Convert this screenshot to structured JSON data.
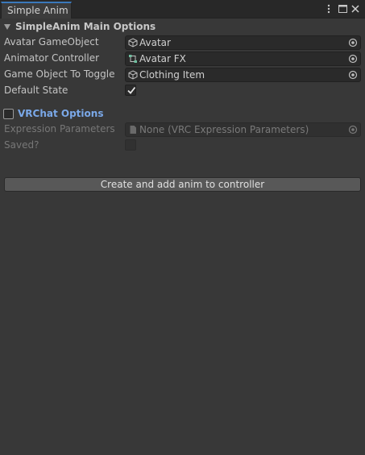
{
  "tab": {
    "title": "Simple Anim"
  },
  "window_controls": {
    "menu_icon": "kebab-menu-icon",
    "maximize_icon": "maximize-icon",
    "close_icon": "close-icon"
  },
  "main_section": {
    "title": "SimpleAnim Main Options",
    "expanded": true,
    "fields": [
      {
        "label": "Avatar GameObject",
        "value": "Avatar",
        "icon": "gameobject-icon"
      },
      {
        "label": "Animator Controller",
        "value": "Avatar FX",
        "icon": "animator-controller-icon"
      },
      {
        "label": "Game Object To Toggle",
        "value": "Clothing Item",
        "icon": "gameobject-icon"
      }
    ],
    "default_state": {
      "label": "Default State",
      "checked": true
    }
  },
  "vrchat_section": {
    "title": "VRChat Options",
    "enabled": false,
    "expression_parameters": {
      "label": "Expression Parameters",
      "value": "None (VRC Expression Parameters)",
      "icon": "scriptable-object-icon"
    },
    "saved": {
      "label": "Saved?",
      "checked": false
    }
  },
  "actions": {
    "create_button": "Create and add anim to controller"
  },
  "colors": {
    "background": "#383838",
    "accent": "#3a79bb",
    "vrchat_title": "#7aa8e8"
  }
}
